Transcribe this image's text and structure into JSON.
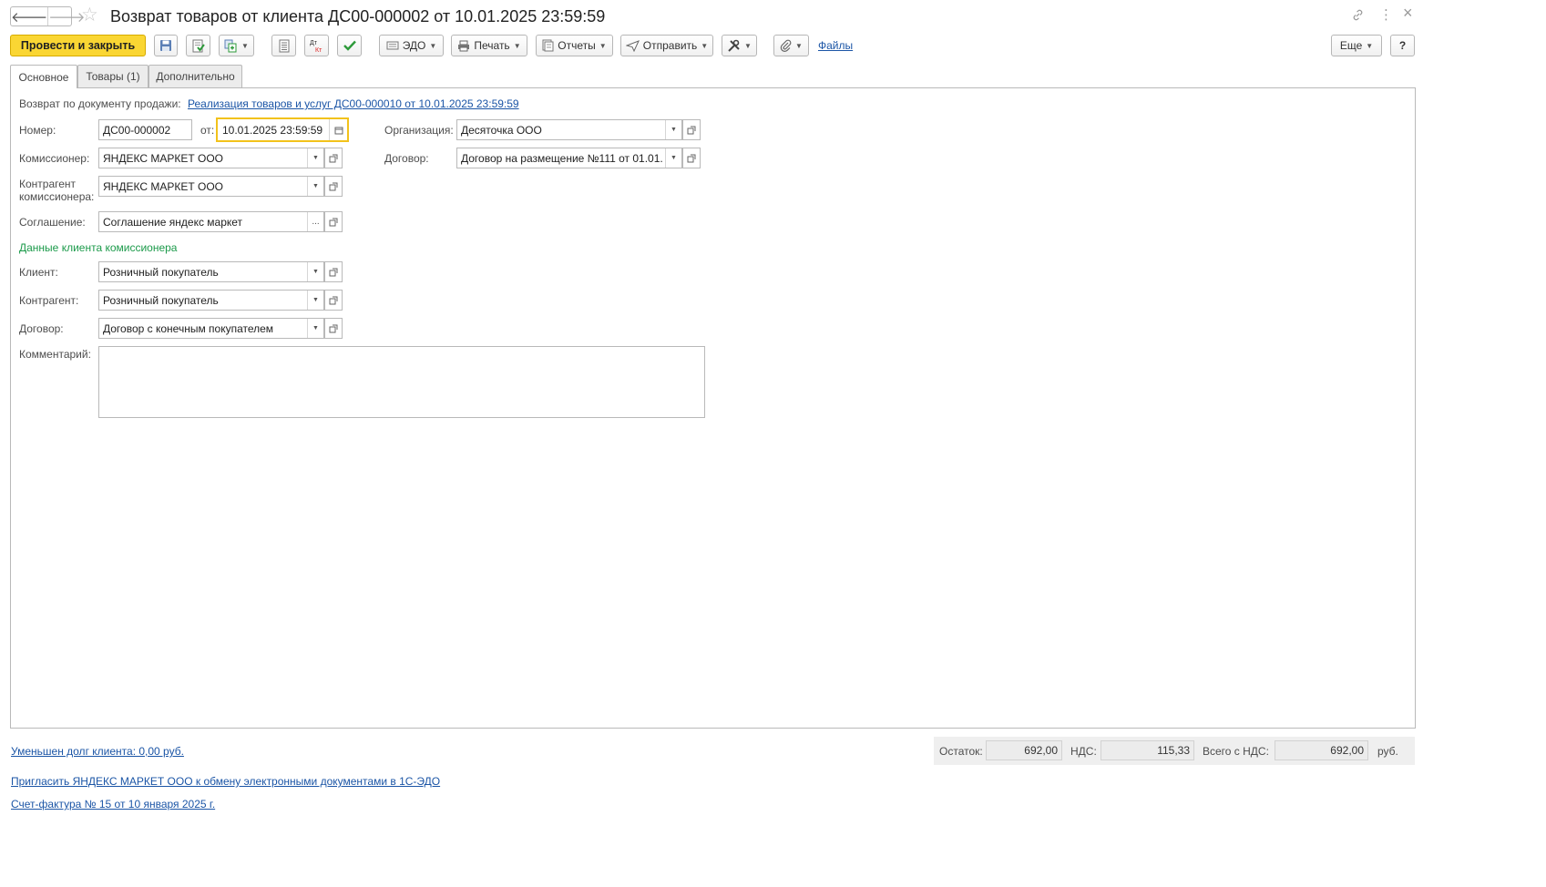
{
  "window": {
    "title": "Возврат товаров от клиента ДС00-000002 от 10.01.2025 23:59:59",
    "nav_back": "🡐",
    "nav_forward": "🡒",
    "star_icon": "☆",
    "link_icon": "🔗",
    "menu_icon": "⋮",
    "close_icon": "×"
  },
  "toolbar": {
    "post_and_close": "Провести и закрыть",
    "edo": "ЭДО",
    "print": "Печать",
    "reports": "Отчеты",
    "send": "Отправить",
    "files": "Файлы",
    "more": "Еще",
    "help": "?",
    "dtkt": "Дт Кт"
  },
  "tabs": [
    {
      "label": "Основное"
    },
    {
      "label": "Товары (1)"
    },
    {
      "label": "Дополнительно"
    }
  ],
  "form": {
    "return_doc_label": "Возврат по документу продажи:",
    "return_doc_link": "Реализация товаров и услуг ДС00-000010 от 10.01.2025 23:59:59",
    "number_label": "Номер:",
    "number_value": "ДС00-000002",
    "date_label": "от:",
    "date_value": "10.01.2025 23:59:59",
    "org_label": "Организация:",
    "org_value": "Десяточка ООО",
    "commissioner_label": "Комиссионер:",
    "commissioner_value": "ЯНДЕКС МАРКЕТ ООО",
    "contract_label": "Договор:",
    "contract_value": "Договор на размещение №111 от 01.01.",
    "counterparty_comm_label_1": "Контрагент",
    "counterparty_comm_label_2": "комиссионера:",
    "counterparty_comm_value": "ЯНДЕКС МАРКЕТ ООО",
    "agreement_label": "Соглашение:",
    "agreement_value": "Соглашение яндекс маркет",
    "agreement_select": "...",
    "section_title": "Данные клиента комиссионера",
    "client_label": "Клиент:",
    "client_value": "Розничный покупатель",
    "counterparty_label": "Контрагент:",
    "counterparty_value": "Розничный покупатель",
    "client_contract_label": "Договор:",
    "client_contract_value": "Договор с конечным покупателем",
    "comment_label": "Комментарий:",
    "comment_value": ""
  },
  "footer": {
    "debt_link": "Уменьшен долг клиента: 0,00 руб.",
    "invite_link": "Пригласить ЯНДЕКС МАРКЕТ ООО к обмену электронными документами в 1С-ЭДО",
    "invoice_link": "Счет-фактура № 15 от 10 января 2025 г.",
    "balance_label": "Остаток:",
    "balance_value": "692,00",
    "vat_label": "НДС:",
    "vat_value": "115,33",
    "total_label": "Всего с НДС:",
    "total_value": "692,00",
    "currency": "руб."
  },
  "colors": {
    "primary_button": "#fad633",
    "link": "#1b55a6",
    "section_title": "#1b9a4a",
    "active_field_border": "#f2c21b"
  }
}
